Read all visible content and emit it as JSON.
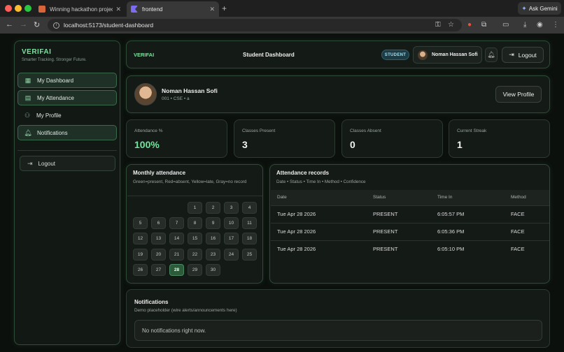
{
  "browser": {
    "tabs": [
      {
        "title": "Winning hackathon project st",
        "close": "✕"
      },
      {
        "title": "frontend",
        "close": "✕"
      }
    ],
    "new_tab": "+",
    "gemini_label": "Ask Gemini",
    "url": "localhost:5173/student-dashboard"
  },
  "sidebar": {
    "brand": "VERIFAI",
    "tagline": "Smarter Tracking. Stronger Future.",
    "items": [
      {
        "label": "My Dashboard",
        "icon": "grid-icon",
        "active": true
      },
      {
        "label": "My Attendance",
        "icon": "clipboard-icon",
        "active": true
      },
      {
        "label": "My Profile",
        "icon": "user-icon",
        "active": false
      },
      {
        "label": "Notifications",
        "icon": "bell-icon",
        "active": true
      }
    ],
    "logout_label": "Logout"
  },
  "topbar": {
    "brand": "VERIFAI",
    "title": "Student Dashboard",
    "role_badge": "STUDENT",
    "user_name": "Noman Hassan Sofi",
    "logout_label": "Logout"
  },
  "profile": {
    "name": "Noman Hassan Sofi",
    "meta": "001 • CSE • a",
    "view_button": "View Profile"
  },
  "stats": [
    {
      "label": "Attendance %",
      "value": "100%"
    },
    {
      "label": "Classes Present",
      "value": "3"
    },
    {
      "label": "Classes Absent",
      "value": "0"
    },
    {
      "label": "Current Streak",
      "value": "1"
    }
  ],
  "calendar": {
    "title": "Monthly attendance",
    "legend": "Green=present, Red=absent, Yellow=late, Gray=no record",
    "days": [
      "1",
      "2",
      "3",
      "4",
      "5",
      "6",
      "7",
      "8",
      "9",
      "10",
      "11",
      "12",
      "13",
      "14",
      "15",
      "16",
      "17",
      "18",
      "19",
      "20",
      "21",
      "22",
      "23",
      "24",
      "25",
      "26",
      "27",
      "28",
      "29",
      "30"
    ],
    "highlighted_day": "28",
    "colors": {
      "present": "#2c5a3a",
      "no_record": "#262c28"
    }
  },
  "records": {
    "title": "Attendance records",
    "subtitle": "Date • Status • Time In • Method • Confidence",
    "columns": [
      "Date",
      "Status",
      "Time In",
      "Method"
    ],
    "rows": [
      [
        "Tue Apr 28 2026",
        "PRESENT",
        "6:05:57 PM",
        "FACE"
      ],
      [
        "Tue Apr 28 2026",
        "PRESENT",
        "6:05:36 PM",
        "FACE"
      ],
      [
        "Tue Apr 28 2026",
        "PRESENT",
        "6:05:10 PM",
        "FACE"
      ]
    ]
  },
  "notifications": {
    "title": "Notifications",
    "subtitle": "Demo placeholder (wire alerts/announcements here)",
    "empty_text": "No notifications right now."
  },
  "theme": {
    "accent": "#7ee0a0",
    "background": "#0c100d",
    "card": "#151a17"
  }
}
